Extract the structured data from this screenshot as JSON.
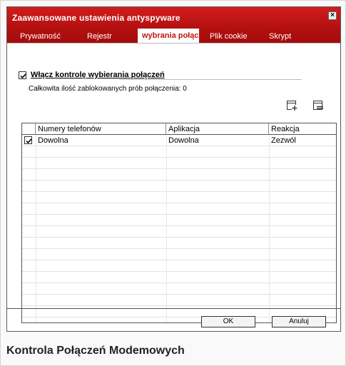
{
  "window": {
    "title": "Zaawansowane ustawienia antyspyware",
    "close_label": "×"
  },
  "tabs": [
    {
      "label": "Prywatność",
      "active": false
    },
    {
      "label": "Rejestr",
      "active": false
    },
    {
      "label": "wybrania połąc",
      "active": true
    },
    {
      "label": "Plik cookie",
      "active": false
    },
    {
      "label": "Skrypt",
      "active": false
    }
  ],
  "dial_control": {
    "enable_label": "Włącz kontrolę wybierania połączeń",
    "enabled": true,
    "blocked_text": "Całkowita ilość zablokowanych prób  połączenia: 0"
  },
  "toolbar": {
    "add_icon": "add-rule-icon",
    "edit_icon": "edit-rule-icon"
  },
  "table": {
    "headers": [
      "",
      "Numery telefonów",
      "Aplikacja",
      "Reakcja"
    ],
    "rows": [
      {
        "checked": true,
        "numbers": "Dowolna",
        "app": "Dowolna",
        "action": "Zezwól"
      }
    ]
  },
  "buttons": {
    "ok": "OK",
    "cancel": "Anuluj"
  },
  "caption": "Kontrola Połączeń Modemowych",
  "colors": {
    "titlebar": "#b31010",
    "active_tab_text": "#c21414"
  }
}
